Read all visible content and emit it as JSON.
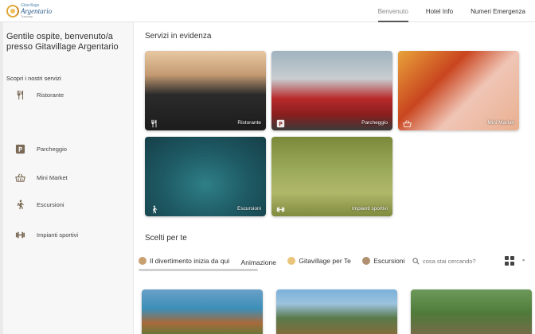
{
  "logo": {
    "small": "Gitavillage",
    "main": "Argentario",
    "sub": "Tuscany"
  },
  "nav": [
    {
      "label": "Benvenuto",
      "active": true
    },
    {
      "label": "Hotel Info",
      "active": false
    },
    {
      "label": "Numeri Emergenza",
      "active": false
    }
  ],
  "sidebar": {
    "welcome": "Gentile ospite, benvenuto/a presso Gitavillage Argentario",
    "discover": "Scopri i nostri servizi",
    "items": [
      {
        "label": "Ristorante",
        "icon": "cutlery-icon"
      },
      {
        "label": "Parcheggio",
        "icon": "parking-icon"
      },
      {
        "label": "Mini Market",
        "icon": "basket-icon"
      },
      {
        "label": "Escursioni",
        "icon": "hiker-icon"
      },
      {
        "label": "Impianti sportivi",
        "icon": "dumbbell-icon"
      }
    ]
  },
  "featured": {
    "title": "Servizi in evidenza",
    "tiles": [
      {
        "label": "Ristorante",
        "icon": "cutlery-icon"
      },
      {
        "label": "Parcheggio",
        "icon": "parking-icon"
      },
      {
        "label": "Mini Market",
        "icon": "basket-icon"
      },
      {
        "label": "Escursioni",
        "icon": "hiker-icon"
      },
      {
        "label": "Impianti sportivi",
        "icon": "dumbbell-icon"
      }
    ]
  },
  "picked": {
    "title": "Scelti per te",
    "chips": [
      {
        "label": "Il divertimento inizia da qui",
        "color": "#c9a070"
      },
      {
        "label": "Animazione",
        "color": ""
      },
      {
        "label": "Gitavillage per Te",
        "color": "#e9c47a"
      },
      {
        "label": "Escursioni",
        "color": "#b09070"
      }
    ],
    "search_placeholder": "cosa stai cercando?"
  },
  "colors": {
    "accent": "#555555",
    "icon": "#7a6a55"
  }
}
